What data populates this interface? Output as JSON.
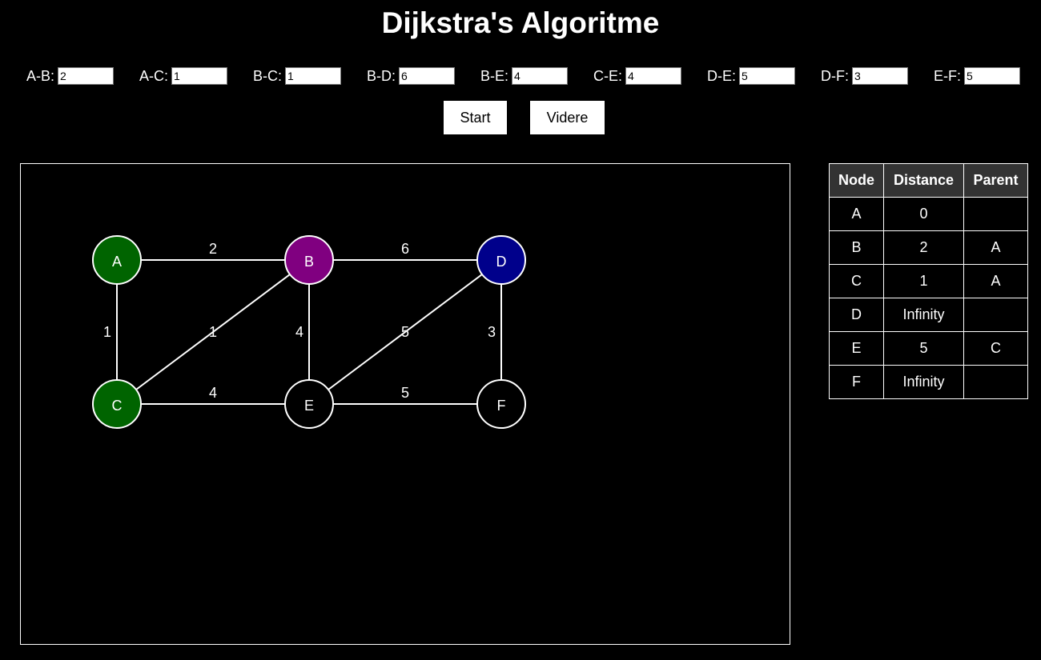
{
  "title": "Dijkstra's Algoritme",
  "weights": [
    {
      "label": "A-B:",
      "value": "2"
    },
    {
      "label": "A-C:",
      "value": "1"
    },
    {
      "label": "B-C:",
      "value": "1"
    },
    {
      "label": "B-D:",
      "value": "6"
    },
    {
      "label": "B-E:",
      "value": "4"
    },
    {
      "label": "C-E:",
      "value": "4"
    },
    {
      "label": "D-E:",
      "value": "5"
    },
    {
      "label": "D-F:",
      "value": "3"
    },
    {
      "label": "E-F:",
      "value": "5"
    }
  ],
  "buttons": {
    "start": "Start",
    "next": "Videre"
  },
  "graph": {
    "nodes": [
      {
        "id": "A",
        "color": "#006400"
      },
      {
        "id": "B",
        "color": "#800080"
      },
      {
        "id": "C",
        "color": "#006400"
      },
      {
        "id": "D",
        "color": "#00008b"
      },
      {
        "id": "E",
        "color": "#000000"
      },
      {
        "id": "F",
        "color": "#000000"
      }
    ],
    "edges": [
      {
        "from": "A",
        "to": "B",
        "weight": "2"
      },
      {
        "from": "A",
        "to": "C",
        "weight": "1"
      },
      {
        "from": "B",
        "to": "C",
        "weight": "1"
      },
      {
        "from": "B",
        "to": "D",
        "weight": "6"
      },
      {
        "from": "B",
        "to": "E",
        "weight": "4"
      },
      {
        "from": "C",
        "to": "E",
        "weight": "4"
      },
      {
        "from": "D",
        "to": "E",
        "weight": "5"
      },
      {
        "from": "D",
        "to": "F",
        "weight": "3"
      },
      {
        "from": "E",
        "to": "F",
        "weight": "5"
      }
    ]
  },
  "table": {
    "headers": [
      "Node",
      "Distance",
      "Parent"
    ],
    "rows": [
      [
        "A",
        "0",
        ""
      ],
      [
        "B",
        "2",
        "A"
      ],
      [
        "C",
        "1",
        "A"
      ],
      [
        "D",
        "Infinity",
        ""
      ],
      [
        "E",
        "5",
        "C"
      ],
      [
        "F",
        "Infinity",
        ""
      ]
    ]
  }
}
